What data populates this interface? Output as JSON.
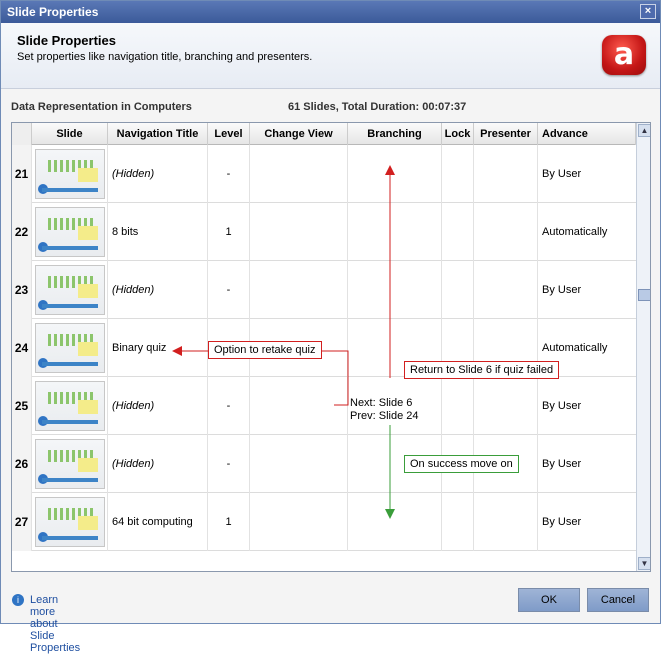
{
  "window": {
    "title": "Slide Properties",
    "close_symbol": "×"
  },
  "header": {
    "title": "Slide Properties",
    "subtitle": "Set properties like navigation title, branching and presenters.",
    "logo_letter": "a"
  },
  "summary": {
    "course": "Data Representation in Computers",
    "stats": "61 Slides, Total Duration: 00:07:37"
  },
  "table": {
    "columns": [
      "Slide",
      "Navigation Title",
      "Level",
      "Change View",
      "Branching",
      "Lock",
      "Presenter",
      "Advance"
    ],
    "rows": [
      {
        "num": "21",
        "title": "(Hidden)",
        "level": "-",
        "advance": "By User"
      },
      {
        "num": "22",
        "title": "8 bits",
        "level": "1",
        "advance": "Automatically"
      },
      {
        "num": "23",
        "title": "(Hidden)",
        "level": "-",
        "advance": "By User"
      },
      {
        "num": "24",
        "title": "Binary quiz",
        "level": "",
        "advance": "Automatically"
      },
      {
        "num": "25",
        "title": "(Hidden)",
        "level": "-",
        "advance": "By User"
      },
      {
        "num": "26",
        "title": "(Hidden)",
        "level": "-",
        "advance": "By User"
      },
      {
        "num": "27",
        "title": "64 bit computing",
        "level": "1",
        "advance": "By User"
      }
    ],
    "branching": {
      "next": "Next: Slide 6",
      "prev": "Prev: Slide 24"
    }
  },
  "annotations": {
    "retake": "Option to retake quiz",
    "return": "Return to Slide 6 if quiz failed",
    "success": "On success move on"
  },
  "footer": {
    "link": "Learn more about Slide Properties",
    "ok": "OK",
    "cancel": "Cancel"
  },
  "colors": {
    "annotation_red": "#d21f1f",
    "annotation_green": "#3a9d3a",
    "button_blue": "#8ca6cf"
  }
}
